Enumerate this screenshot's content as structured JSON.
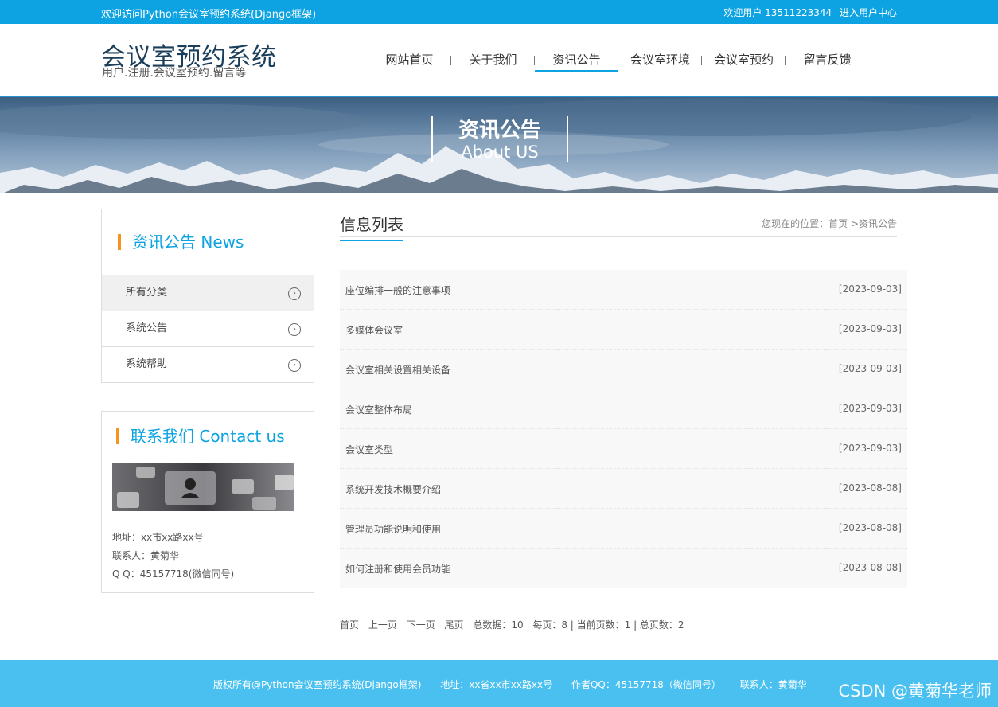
{
  "topbar": {
    "welcome": "欢迎访问Python会议室预约系统(Django框架)",
    "user_greeting": "欢迎用户 13511223344",
    "user_center": "进入用户中心"
  },
  "header": {
    "site_title": "会议室预约系统",
    "site_subtitle": "用户.注册.会议室预约.留言等"
  },
  "nav": {
    "items": [
      {
        "label": "网站首页"
      },
      {
        "label": "关于我们"
      },
      {
        "label": "资讯公告"
      },
      {
        "label": "会议室环境"
      },
      {
        "label": "会议室预约"
      },
      {
        "label": "留言反馈"
      }
    ],
    "active": "资讯公告"
  },
  "banner": {
    "title_cn": "资讯公告",
    "title_en": "About US"
  },
  "sidebar": {
    "news_heading": "资讯公告 News",
    "categories": [
      {
        "label": "所有分类"
      },
      {
        "label": "系统公告"
      },
      {
        "label": "系统帮助"
      }
    ],
    "contact_heading": "联系我们 Contact us",
    "address": "地址：xx市xx路xx号",
    "contact_person": "联系人：黄菊华",
    "qq": "Q Q：45157718(微信同号)"
  },
  "main": {
    "title": "信息列表",
    "breadcrumb_prefix": "您现在的位置：",
    "breadcrumb_home": "首页",
    "breadcrumb_current": ">资讯公告",
    "articles": [
      {
        "title": "座位编排一般的注意事项",
        "date": "[2023-09-03]"
      },
      {
        "title": "多媒体会议室",
        "date": "[2023-09-03]"
      },
      {
        "title": "会议室相关设置相关设备",
        "date": "[2023-09-03]"
      },
      {
        "title": "会议室整体布局",
        "date": "[2023-09-03]"
      },
      {
        "title": "会议室类型",
        "date": "[2023-09-03]"
      },
      {
        "title": "系统开发技术概要介绍",
        "date": "[2023-08-08]"
      },
      {
        "title": "管理员功能说明和使用",
        "date": "[2023-08-08]"
      },
      {
        "title": "如何注册和使用会员功能",
        "date": "[2023-08-08]"
      }
    ]
  },
  "pager": {
    "first": "首页",
    "prev": "上一页",
    "next": "下一页",
    "last": "尾页",
    "stats": "总数据：10 | 每页：8 | 当前页数：1 | 总页数：2"
  },
  "footer": {
    "copyright": "版权所有@Python会议室预约系统(Django框架)",
    "address": "地址：xx省xx市xx路xx号",
    "qq": "作者QQ：45157718（微信同号）",
    "contact": "联系人：黄菊华"
  },
  "watermark": "CSDN @黄菊华老师",
  "colors": {
    "accent": "#0da3e2",
    "highlight": "#f7941d",
    "footer": "#49c0f0"
  }
}
